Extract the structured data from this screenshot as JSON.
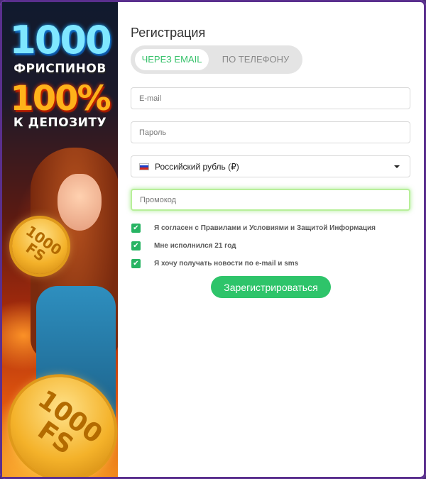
{
  "banner": {
    "line1": "1000",
    "line2": "ФРИСПИНОВ",
    "line3": "100%",
    "line4": "К ДЕПОЗИТУ",
    "coin_small": "1000 FS",
    "coin_large": "1000 FS"
  },
  "form": {
    "title": "Регистрация",
    "tabs": [
      {
        "label": "ЧЕРЕЗ EMAIL",
        "active": true
      },
      {
        "label": "ПО ТЕЛЕФОНУ",
        "active": false
      }
    ],
    "email": {
      "placeholder": "E-mail",
      "value": ""
    },
    "password": {
      "placeholder": "Пароль",
      "value": ""
    },
    "currency": {
      "selected": "Российский рубль (₽)",
      "icon": "flag-ru-icon"
    },
    "promo": {
      "placeholder": "Промокод",
      "value": ""
    },
    "checkboxes": [
      {
        "label": "Я согласен с Правилами и Условиями и Защитой Информация",
        "checked": true
      },
      {
        "label": "Мне исполнился 21 год",
        "checked": true
      },
      {
        "label": "Я хочу получать новости по e-mail и sms",
        "checked": true
      }
    ],
    "submit_label": "Зарегистрироваться"
  },
  "colors": {
    "accent": "#2ec46a",
    "tab_active_text": "#37c26b",
    "frame": "#5a2f8e",
    "promo_focus": "#b8ef9a"
  }
}
